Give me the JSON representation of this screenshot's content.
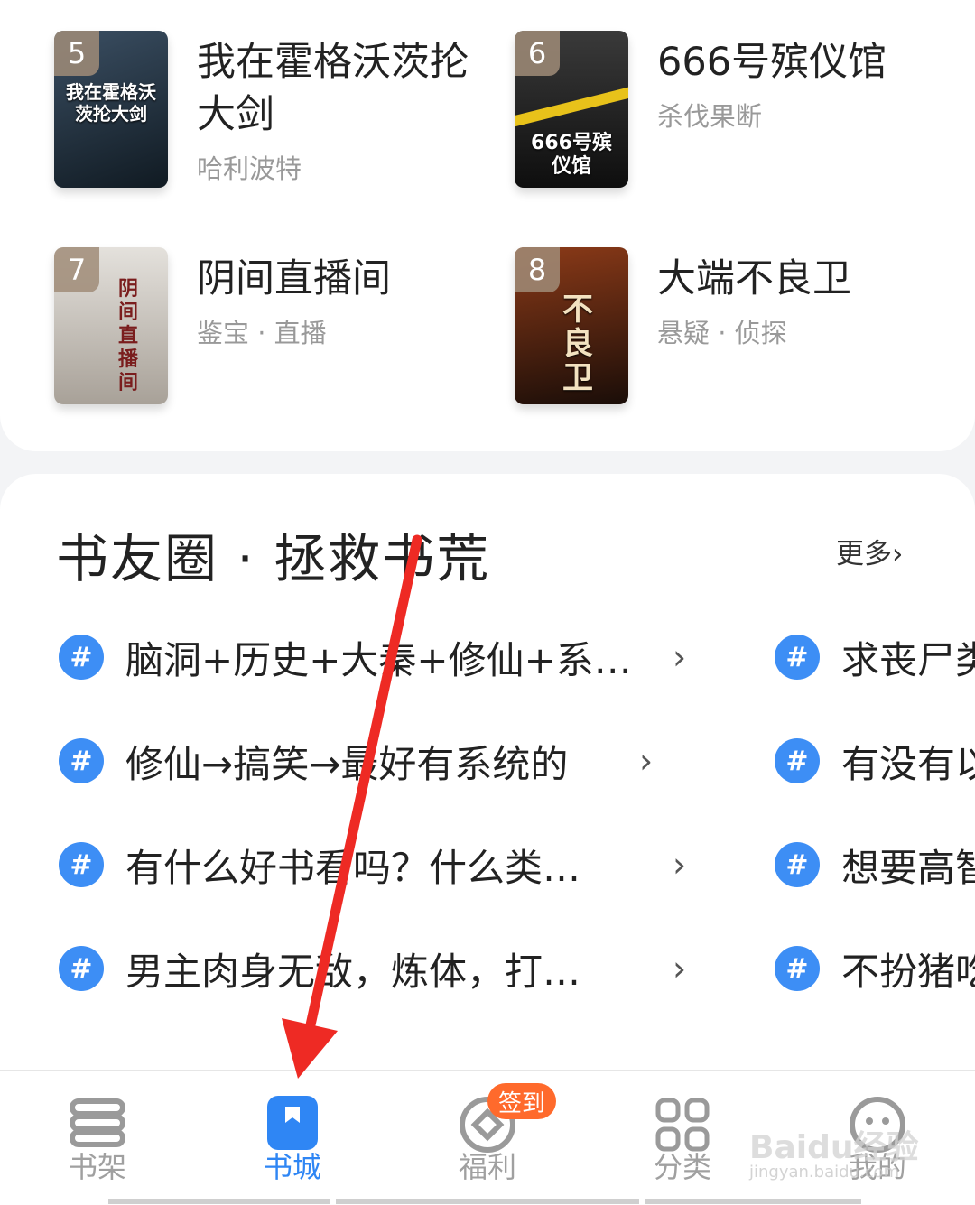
{
  "ranking": {
    "books": [
      {
        "rank": "5",
        "title": "我在霍格沃茨抡大剑",
        "subtitle": "哈利波特",
        "cover_text": "我在霍格沃茨抡大剑",
        "cover_colors": [
          "#2a3b4a",
          "#0f1a24"
        ]
      },
      {
        "rank": "6",
        "title": "666号殡仪馆",
        "subtitle": "杀伐果断",
        "cover_text": "666号殡仪馆",
        "cover_colors": [
          "#2b2b2b",
          "#111111"
        ]
      },
      {
        "rank": "7",
        "title": "阴间直播间",
        "subtitle": "鉴宝 · 直播",
        "cover_text": "阴间直播间",
        "cover_colors": [
          "#d9d6d0",
          "#a9a39a"
        ]
      },
      {
        "rank": "8",
        "title": "大端不良卫",
        "subtitle": "悬疑 · 侦探",
        "cover_text": "不良卫",
        "cover_colors": [
          "#6b2a14",
          "#1a0d08"
        ]
      }
    ]
  },
  "circle": {
    "title": "书友圈 · 拯救书荒",
    "more": "更多›",
    "topics_left": [
      {
        "text": "脑洞+历史+大秦+修仙+系…",
        "chev": "›"
      },
      {
        "text": "修仙→搞笑→最好有系统的",
        "chev": "›"
      },
      {
        "text": "有什么好书看吗？什么类…",
        "chev": "›"
      },
      {
        "text": "男主肉身无敌，炼体，打…",
        "chev": "›"
      }
    ],
    "topics_right": [
      {
        "text": "求丧尸类"
      },
      {
        "text": "有没有以"
      },
      {
        "text": "想要高智"
      },
      {
        "text": "不扮猪吃"
      }
    ],
    "hash_icon": "#"
  },
  "tabbar": {
    "tabs": [
      {
        "label": "书架",
        "icon": "bookshelf-icon"
      },
      {
        "label": "书城",
        "icon": "bookstore-icon",
        "active": true
      },
      {
        "label": "福利",
        "icon": "coin-icon",
        "badge": "签到"
      },
      {
        "label": "分类",
        "icon": "grid-icon"
      },
      {
        "label": "我的",
        "icon": "smiley-icon"
      }
    ],
    "active_color": "#2f86f4",
    "badge_color": "#ff6a2c"
  },
  "watermark": {
    "text": "Baidu经验",
    "url_text": "jingyan.baidu.com"
  },
  "annotation": {
    "arrow_color": "#ee2a24"
  }
}
